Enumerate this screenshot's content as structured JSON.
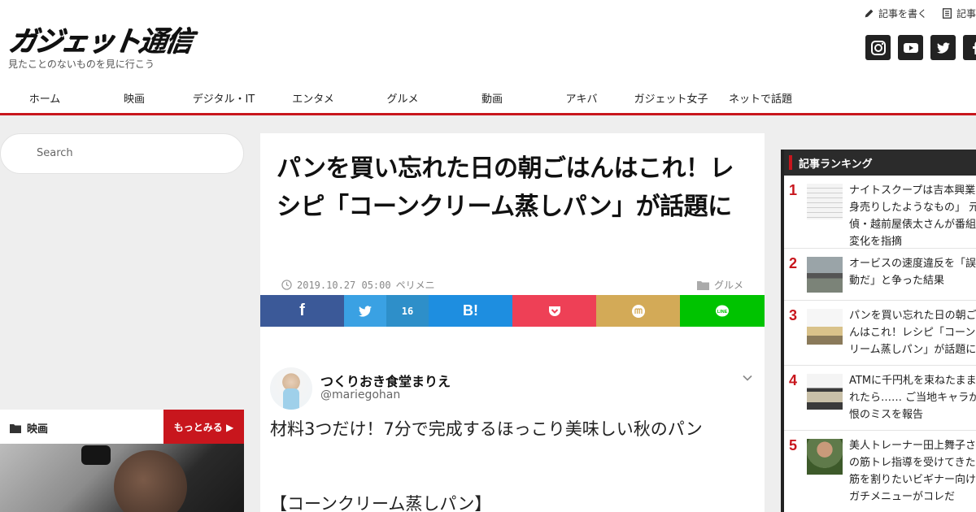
{
  "header": {
    "logo_text": "ガジェット通信",
    "tagline": "見たことのないものを見に行こう",
    "top_links": [
      {
        "label": "記事を書く",
        "icon": "pencil-icon"
      },
      {
        "label": "記事",
        "icon": "document-icon"
      }
    ],
    "social": [
      "instagram-icon",
      "youtube-icon",
      "twitter-icon",
      "facebook-icon"
    ]
  },
  "nav": {
    "items": [
      "ホーム",
      "映画",
      "デジタル・IT",
      "エンタメ",
      "グルメ",
      "動画",
      "アキバ",
      "ガジェット女子",
      "ネットで話題"
    ]
  },
  "sidebar": {
    "search_placeholder": "Search",
    "movie_section": {
      "title": "映画",
      "more_label": "もっとみる ▶"
    }
  },
  "article": {
    "title": "パンを買い忘れた日の朝ごはんはこれ！レシピ「コーンクリーム蒸しパン」が話題に",
    "date": "2019.10.27 05:00",
    "author": "ペリメニ",
    "category": "グルメ",
    "share": {
      "facebook": "f",
      "hatena": "B!",
      "twitter_count": "16"
    },
    "tweet": {
      "name": "つくりおき食堂まりえ",
      "handle": "@mariegohan",
      "body": "材料3つだけ！7分で完成するほっこり美味しい秋のパン",
      "body2": "【コーンクリーム蒸しパン】"
    }
  },
  "ranking": {
    "title": "記事ランキング",
    "items": [
      {
        "num": "1",
        "text": "ナイトスクープは吉本興業に身売りしたようなもの」 元探偵・越前屋俵太さんが番組の変化を指摘"
      },
      {
        "num": "2",
        "text": "オービスの速度違反を「誤作動だ」と争った結果"
      },
      {
        "num": "3",
        "text": "パンを買い忘れた日の朝ごはんはこれ！レシピ「コーンクリーム蒸しパン」が話題に"
      },
      {
        "num": "4",
        "text": "ATMに千円札を束ねたまま入れたら…… ご当地キャラが痛恨のミスを報告"
      },
      {
        "num": "5",
        "text": "美人トレーナー田上舞子さんの筋トレ指導を受けてきた 腹筋を割りたいビギナー向けのガチメニューがコレだ"
      }
    ]
  },
  "colors": {
    "brand_red": "#c8161d",
    "facebook": "#3b5998",
    "twitter": "#3aa1e3",
    "hatena": "#1e8ee0",
    "pocket": "#ee4056",
    "mixi": "#d3aa57",
    "line": "#00c300"
  }
}
